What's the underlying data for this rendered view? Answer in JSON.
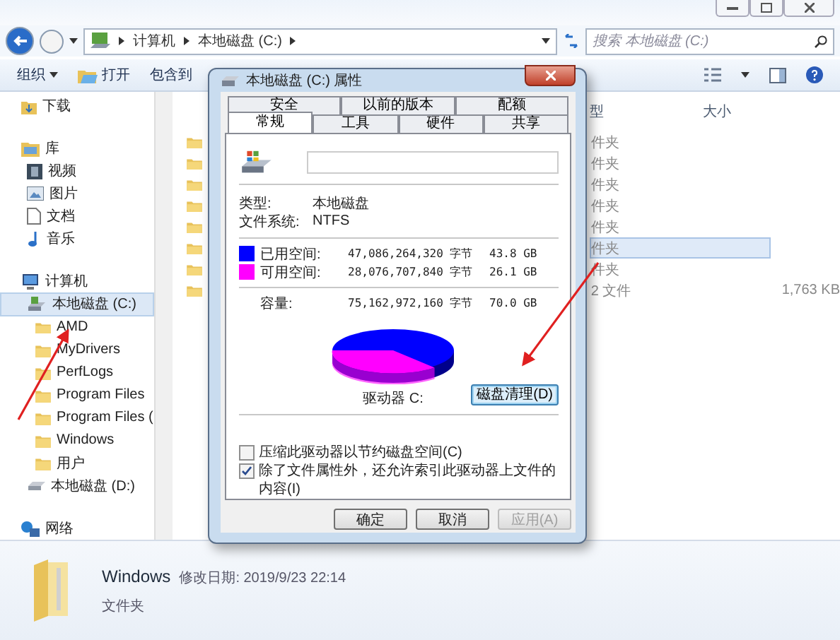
{
  "address_bar": {
    "crumbs": [
      "计算机",
      "本地磁盘 (C:)"
    ],
    "search_placeholder": "搜索 本地磁盘 (C:)"
  },
  "toolbar": {
    "items": [
      {
        "label": "组织",
        "kind": "menu"
      },
      {
        "label": "打开",
        "kind": "open"
      },
      {
        "label": "包含到",
        "kind": "plain"
      }
    ]
  },
  "sidebar": {
    "items": [
      {
        "label": "下载",
        "selected": false
      },
      {
        "label": "库",
        "selected": false,
        "children": [
          {
            "label": "视频",
            "selected": false
          },
          {
            "label": "图片",
            "selected": false
          },
          {
            "label": "文档",
            "selected": false
          },
          {
            "label": "音乐",
            "selected": false
          }
        ]
      },
      {
        "label": "计算机",
        "selected": false,
        "children": [
          {
            "label": "本地磁盘 (C:)",
            "selected": true,
            "children": [
              {
                "label": "AMD",
                "selected": false
              },
              {
                "label": "MyDrivers",
                "selected": false
              },
              {
                "label": "PerfLogs",
                "selected": false
              },
              {
                "label": "Program Files",
                "selected": false
              },
              {
                "label": "Program Files (",
                "selected": false
              },
              {
                "label": "Windows",
                "selected": false
              },
              {
                "label": "用户",
                "selected": false
              }
            ]
          },
          {
            "label": "本地磁盘 (D:)",
            "selected": false
          }
        ]
      },
      {
        "label": "网络",
        "selected": false
      }
    ]
  },
  "file_list": {
    "columns": [
      "型",
      "大小"
    ],
    "rows": [
      {
        "type": "件夹",
        "selected": false
      },
      {
        "type": "件夹",
        "selected": false
      },
      {
        "type": "件夹",
        "selected": false
      },
      {
        "type": "件夹",
        "selected": false
      },
      {
        "type": "件夹",
        "selected": false
      },
      {
        "type": "件夹",
        "selected": true
      },
      {
        "type": "件夹",
        "selected": false
      },
      {
        "type": "2 文件",
        "size": "1,763 KB",
        "selected": false
      }
    ]
  },
  "dialog": {
    "title": "本地磁盘 (C:) 属性",
    "tabs_back": [
      {
        "label": "安全",
        "selected": false
      },
      {
        "label": "以前的版本",
        "selected": false
      },
      {
        "label": "配额",
        "selected": false
      }
    ],
    "tabs_front": [
      {
        "label": "常规",
        "selected": true
      },
      {
        "label": "工具",
        "selected": false
      },
      {
        "label": "硬件",
        "selected": false
      },
      {
        "label": "共享",
        "selected": false
      }
    ],
    "properties": [
      {
        "label": "类型:",
        "value": "本地磁盘"
      },
      {
        "label": "文件系统:",
        "value": "NTFS"
      }
    ],
    "space": [
      {
        "label": "已用空间:",
        "bytes": "47,086,264,320 字节",
        "size": "43.8 GB",
        "color": "#0000ff"
      },
      {
        "label": "可用空间:",
        "bytes": "28,076,707,840 字节",
        "size": "26.1 GB",
        "color": "#ff00ff"
      }
    ],
    "capacity": {
      "label": "容量:",
      "bytes": "75,162,972,160 字节",
      "size": "70.0 GB"
    },
    "drive_label": "驱动器 C:",
    "cleanup_button": {
      "label": "磁盘清理(D)",
      "focused": true
    },
    "options": [
      {
        "label": "压缩此驱动器以节约磁盘空间(C)",
        "checked": false
      },
      {
        "label": "除了文件属性外，还允许索引此驱动器上文件的内容(I)",
        "checked": true
      }
    ],
    "buttons": [
      {
        "label": "确定",
        "disabled": false
      },
      {
        "label": "取消",
        "disabled": false
      },
      {
        "label": "应用(A)",
        "disabled": true
      }
    ]
  },
  "status_bar": {
    "name": "Windows",
    "modified": "修改日期: 2019/9/23 22:14",
    "type": "文件夹"
  }
}
